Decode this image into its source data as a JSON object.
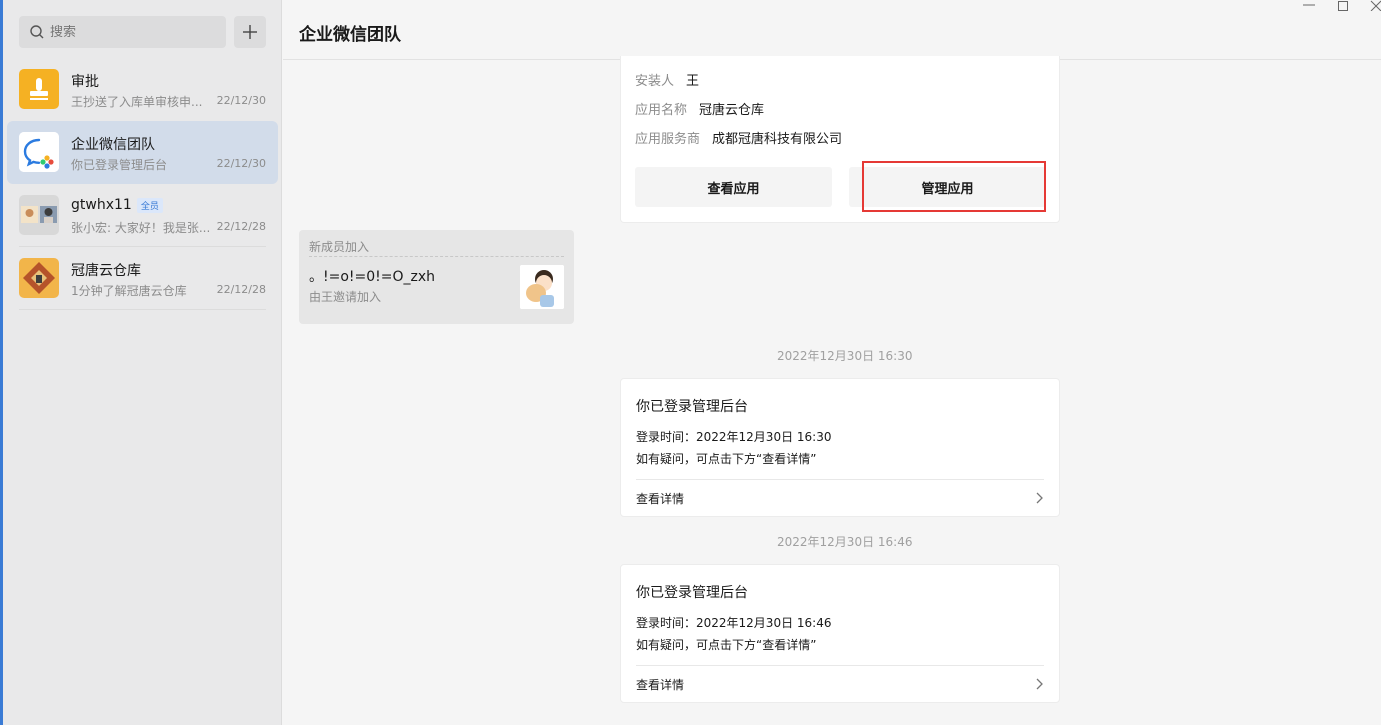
{
  "sidebar": {
    "search_placeholder": "搜索",
    "conversations": [
      {
        "name": "审批",
        "preview": "王抄送了入库单审核申...",
        "date": "22/12/30",
        "avatar": "approval-icon"
      },
      {
        "name": "企业微信团队",
        "preview": "你已登录管理后台",
        "date": "22/12/30",
        "avatar": "wecom-logo",
        "active": true
      },
      {
        "name": "gtwhx11",
        "tag": "全员",
        "preview": "张小宏: 大家好！我是张...",
        "date": "22/12/28",
        "avatar": "group-avatar"
      },
      {
        "name": "冠唐云仓库",
        "preview": "1分钟了解冠唐云仓库",
        "date": "22/12/28",
        "avatar": "warehouse-logo"
      }
    ]
  },
  "header": {
    "title": "企业微信团队"
  },
  "app_card": {
    "installer_label": "安装人",
    "installer_value": "王",
    "app_name_label": "应用名称",
    "app_name_value": "冠唐云仓库",
    "provider_label": "应用服务商",
    "provider_value": "成都冠唐科技有限公司",
    "view_app": "查看应用",
    "manage_app": "管理应用"
  },
  "member_card": {
    "title": "新成员加入",
    "name": "。!=o!=0!=O_zxh",
    "invited_by": "由王邀请加入"
  },
  "messages": [
    {
      "timestamp": "2022年12月30日 16:30",
      "title": "你已登录管理后台",
      "login_time": "登录时间：2022年12月30日 16:30",
      "hint": "如有疑问，可点击下方“查看详情”",
      "link": "查看详情"
    },
    {
      "timestamp": "2022年12月30日 16:46",
      "title": "你已登录管理后台",
      "login_time": "登录时间：2022年12月30日 16:46",
      "hint": "如有疑问，可点击下方“查看详情”",
      "link": "查看详情"
    }
  ],
  "colors": {
    "accent": "#3a7bd5",
    "highlight": "#e53935",
    "active_row": "#d2dcea"
  }
}
